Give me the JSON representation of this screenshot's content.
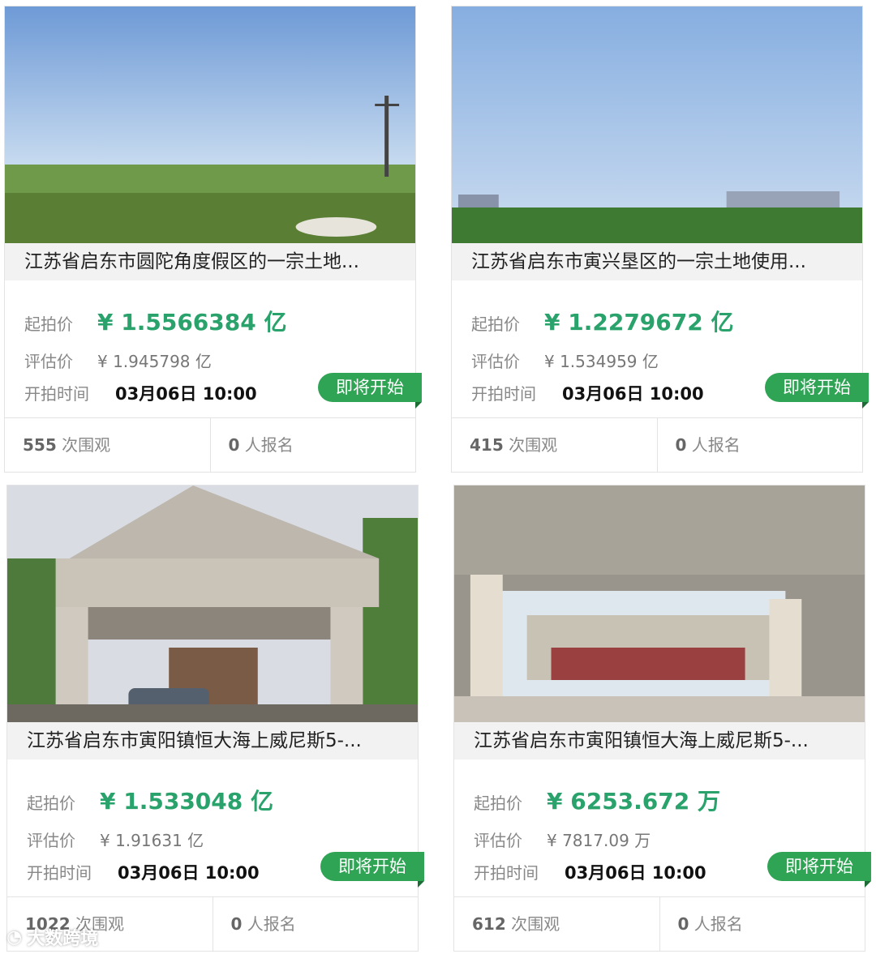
{
  "listings": [
    {
      "title": "江苏省启东市圆陀角度假区的一宗土地...",
      "start_label": "起拍价",
      "start_price": "¥ 1.5566384 亿",
      "eval_label": "评估价",
      "eval_price": "¥ 1.945798 亿",
      "time_label": "开拍时间",
      "time": "03月06日 10:00",
      "status": "即将开始",
      "views": "555",
      "views_label": "次围观",
      "signups": "0",
      "signups_label": "人报名"
    },
    {
      "title": "江苏省启东市寅兴垦区的一宗土地使用...",
      "start_label": "起拍价",
      "start_price": "¥ 1.2279672 亿",
      "eval_label": "评估价",
      "eval_price": "¥ 1.534959 亿",
      "time_label": "开拍时间",
      "time": "03月06日 10:00",
      "status": "即将开始",
      "views": "415",
      "views_label": "次围观",
      "signups": "0",
      "signups_label": "人报名"
    },
    {
      "title": "江苏省启东市寅阳镇恒大海上威尼斯5-...",
      "start_label": "起拍价",
      "start_price": "¥ 1.533048 亿",
      "eval_label": "评估价",
      "eval_price": "¥ 1.91631 亿",
      "time_label": "开拍时间",
      "time": "03月06日 10:00",
      "status": "即将开始",
      "views": "1022",
      "views_label": "次围观",
      "signups": "0",
      "signups_label": "人报名"
    },
    {
      "title": "江苏省启东市寅阳镇恒大海上威尼斯5-...",
      "start_label": "起拍价",
      "start_price": "¥ 6253.672 万",
      "eval_label": "评估价",
      "eval_price": "¥ 7817.09 万",
      "time_label": "开拍时间",
      "time": "03月06日 10:00",
      "status": "即将开始",
      "views": "612",
      "views_label": "次围观",
      "signups": "0",
      "signups_label": "人报名"
    }
  ],
  "watermark": "大数跨境",
  "colors": {
    "accent": "#2aa26b",
    "badge": "#30a455",
    "border": "#e3e3e3"
  }
}
